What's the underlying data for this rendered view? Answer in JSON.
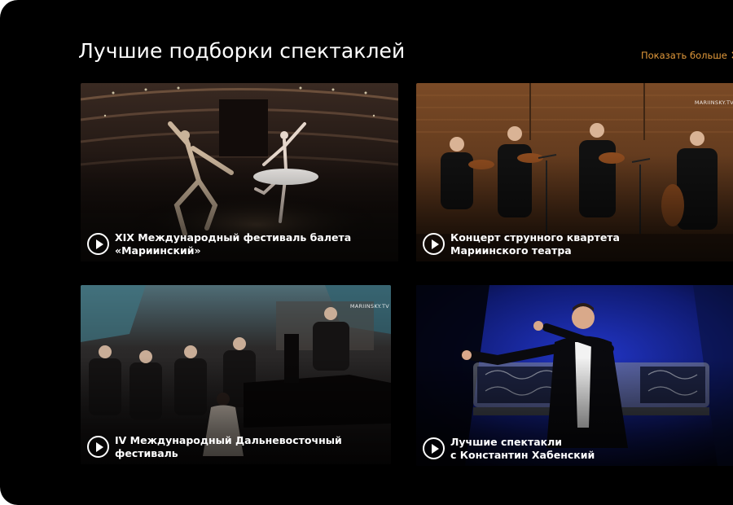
{
  "section": {
    "title": "Лучшие подборки спектаклей",
    "show_more_label": "Показать больше"
  },
  "cards": [
    {
      "line1": "XIX Международный фестиваль балета",
      "line2": "«Мариинский»",
      "watermark": ""
    },
    {
      "line1": "Концерт струнного квартета",
      "line2": "Мариинского театра",
      "watermark": "MARIINSKY.TV"
    },
    {
      "line1": "IV Международный Дальневосточный",
      "line2": "фестиваль",
      "watermark": "MARIINSKY.TV"
    },
    {
      "line1": "Лучшие спектакли",
      "line2": "с Константин Хабенский",
      "watermark": ""
    }
  ],
  "colors": {
    "background": "#000000",
    "accent": "#e39a3b",
    "text": "#ffffff"
  },
  "icons": {
    "play": "play-circle-icon",
    "more": "chevron-right-icon"
  }
}
